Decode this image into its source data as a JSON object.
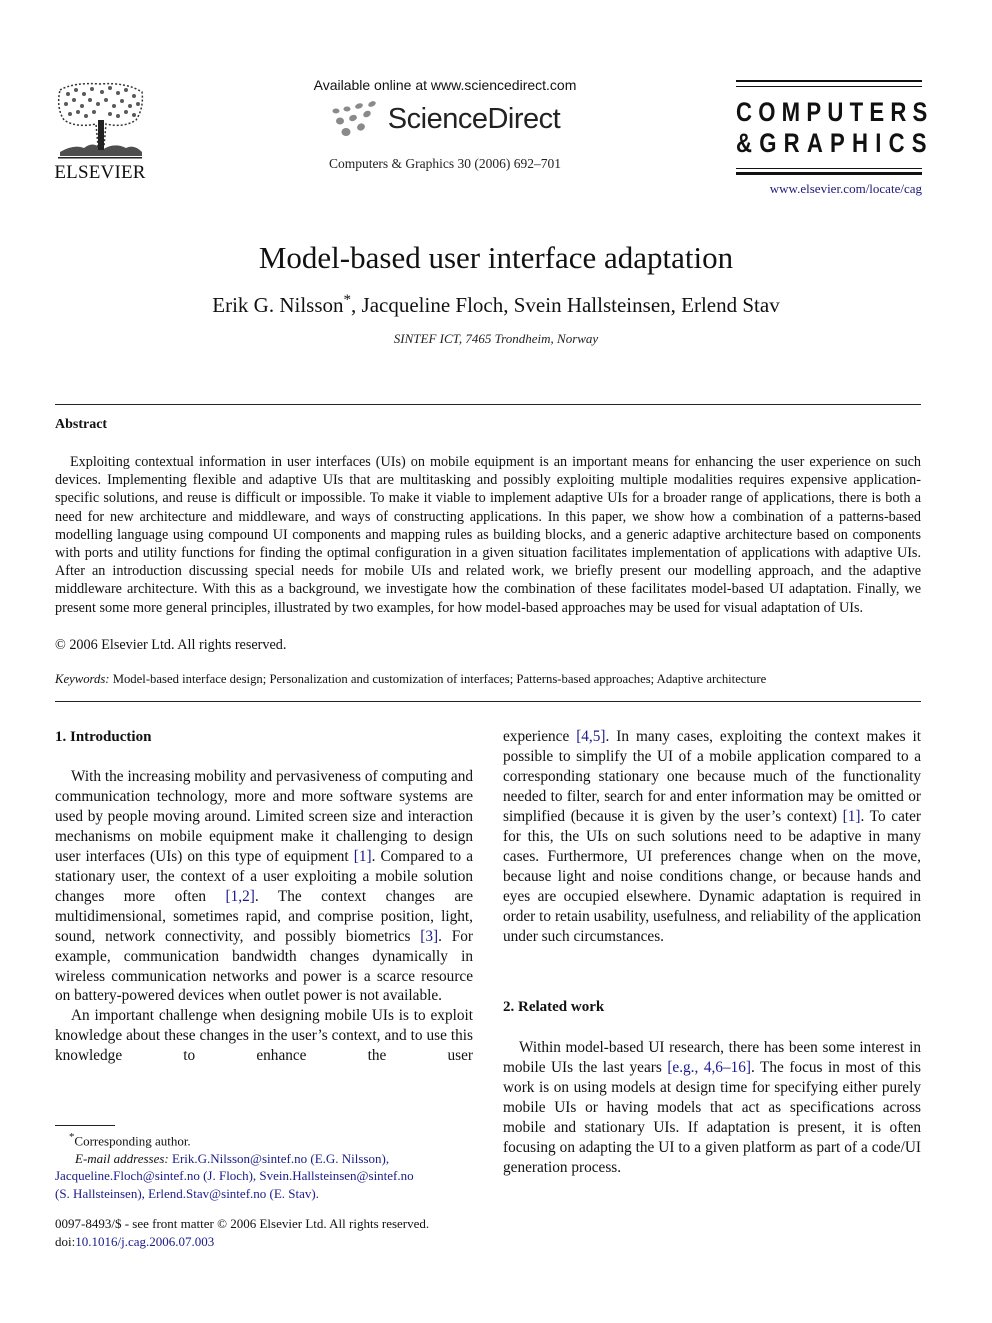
{
  "header": {
    "publisher": "ELSEVIER",
    "available_online": "Available online at www.sciencedirect.com",
    "sciencedirect_logo": "ScienceDirect",
    "journal_ref": "Computers & Graphics 30 (2006) 692–701",
    "journal_title_line1": "COMPUTERS",
    "journal_title_line2": "&GRAPHICS",
    "journal_url": "www.elsevier.com/locate/cag"
  },
  "article": {
    "title": "Model-based user interface adaptation",
    "authors": "Erik G. Nilsson",
    "authors_mark": "*",
    "authors_rest": ", Jacqueline Floch, Svein Hallsteinsen, Erlend Stav",
    "affiliation": "SINTEF ICT, 7465 Trondheim, Norway"
  },
  "abstract": {
    "heading": "Abstract",
    "body": "Exploiting contextual information in user interfaces (UIs) on mobile equipment is an important means for enhancing the user experience on such devices. Implementing flexible and adaptive UIs that are multitasking and possibly exploiting multiple modalities requires expensive application-specific solutions, and reuse is difficult or impossible. To make it viable to implement adaptive UIs for a broader range of applications, there is both a need for new architecture and middleware, and ways of constructing applications. In this paper, we show how a combination of a patterns-based modelling language using compound UI components and mapping rules as building blocks, and a generic adaptive architecture based on components with ports and utility functions for finding the optimal configuration in a given situation facilitates implementation of applications with adaptive UIs. After an introduction discussing special needs for mobile UIs and related work, we briefly present our modelling approach, and the adaptive middleware architecture. With this as a background, we investigate how the combination of these facilitates model-based UI adaptation. Finally, we present some more general principles, illustrated by two examples, for how model-based approaches may be used for visual adaptation of UIs.",
    "copyright": "© 2006 Elsevier Ltd. All rights reserved."
  },
  "keywords": {
    "label": "Keywords:",
    "text": " Model-based interface design; Personalization and customization of interfaces; Patterns-based approaches; Adaptive architecture"
  },
  "sections": {
    "intro": {
      "heading": "1.  Introduction",
      "p1_a": "With the increasing mobility and pervasiveness of computing and communication technology, more and more software systems are used by people moving around. Limited screen size and interaction mechanisms on mobile equipment make it challenging to design user interfaces (UIs) on this type of equipment ",
      "p1_c1": "[1]",
      "p1_b": ". Compared to a stationary user, the context of a user exploiting a mobile solution changes more often ",
      "p1_c2": "[1,2]",
      "p1_c": ". The context changes are multidimensional, sometimes rapid, and comprise position, light, sound, network connectivity, and possibly biometrics ",
      "p1_c3": "[3]",
      "p1_d": ". For example, communication bandwidth changes dynamically in wireless communication networks and power is a scarce resource on battery-powered devices when outlet power is not available.",
      "p2_a": "An important challenge when designing mobile UIs is to exploit knowledge about these changes in the user’s context, and to use this knowledge to enhance the user",
      "p2_cont_a": "experience ",
      "p2_c1": "[4,5]",
      "p2_cont_b": ". In many cases, exploiting the context makes it possible to simplify the UI of a mobile application compared to a corresponding stationary one because much of the functionality needed to filter, search for and enter information may be omitted or simplified (because it is given by the user’s context) ",
      "p2_c2": "[1]",
      "p2_cont_c": ". To cater for this, the UIs on such solutions need to be adaptive in many cases. Furthermore, UI preferences change when on the move, because light and noise conditions change, or because hands and eyes are occupied elsewhere. Dynamic adaptation is required in order to retain usability, usefulness, and reliability of the application under such circumstances."
    },
    "related": {
      "heading": "2.  Related work",
      "p1_a": "Within model-based UI research, there has been some interest in mobile UIs the last years ",
      "p1_c1": "[e.g., 4,6–16]",
      "p1_b": ". The focus in most of this work is on using models at design time for specifying either purely mobile UIs or having models that act as specifications across mobile and stationary UIs. If adaptation is present, it is often focusing on adapting the UI to a given platform as part of a code/UI generation process."
    }
  },
  "footnotes": {
    "mark": "*",
    "corresponding": "Corresponding author.",
    "email_label": "E-mail addresses:",
    "email1": "Erik.G.Nilsson@sintef.no (E.G. Nilsson),",
    "email2": "Jacqueline.Floch@sintef.no (J. Floch), Svein.Hallsteinsen@sintef.no",
    "email3": "(S. Hallsteinsen), Erlend.Stav@sintef.no (E. Stav).",
    "issn": "0097-8493/$ - see front matter © 2006 Elsevier Ltd. All rights reserved.",
    "doi_label": "doi:",
    "doi": "10.1016/j.cag.2006.07.003"
  }
}
